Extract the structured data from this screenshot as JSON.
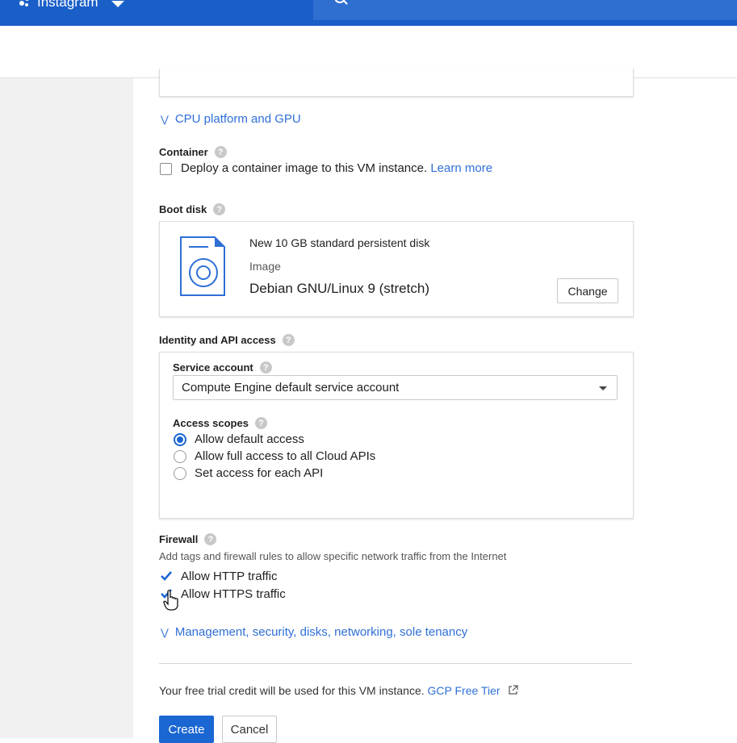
{
  "topbar": {
    "project_name": "Instagram",
    "project_icon": "project-dots-icon",
    "search_icon": "search-icon"
  },
  "cpu_platform": {
    "label": "CPU platform and GPU"
  },
  "container": {
    "label": "Container",
    "checkbox_label": "Deploy a container image to this VM instance.",
    "learn_more": "Learn more"
  },
  "boot_disk": {
    "label": "Boot disk",
    "disk_title": "New 10 GB standard persistent disk",
    "image_label": "Image",
    "image_value": "Debian GNU/Linux 9 (stretch)",
    "change_button": "Change"
  },
  "identity": {
    "label": "Identity and API access",
    "service_account_label": "Service account",
    "service_account_value": "Compute Engine default service account",
    "access_scopes_label": "Access scopes",
    "scopes": [
      {
        "label": "Allow default access",
        "selected": true
      },
      {
        "label": "Allow full access to all Cloud APIs",
        "selected": false
      },
      {
        "label": "Set access for each API",
        "selected": false
      }
    ]
  },
  "firewall": {
    "label": "Firewall",
    "description": "Add tags and firewall rules to allow specific network traffic from the Internet",
    "http_label": "Allow HTTP traffic",
    "https_label": "Allow HTTPS traffic",
    "http_checked": true,
    "https_checked": true
  },
  "management": {
    "label": "Management, security, disks, networking, sole tenancy"
  },
  "footer": {
    "trial_text": "Your free trial credit will be used for this VM instance.",
    "free_tier_link": "GCP Free Tier",
    "create_button": "Create",
    "cancel_button": "Cancel"
  },
  "colors": {
    "topbar": "#1a5fc8",
    "link": "#2f6fd6",
    "primary_button": "#1a66d2"
  }
}
